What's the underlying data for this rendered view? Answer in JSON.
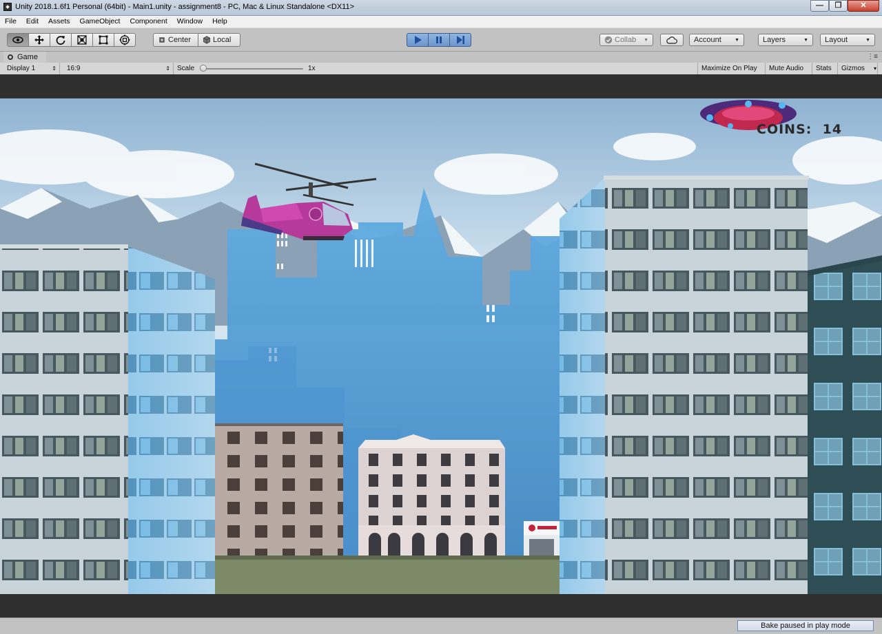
{
  "window": {
    "title": "Unity 2018.1.6f1 Personal (64bit) - Main1.unity - assignment8 - PC, Mac & Linux Standalone <DX11>",
    "minimize_glyph": "—",
    "restore_glyph": "❐",
    "close_glyph": "✕"
  },
  "menu": [
    "File",
    "Edit",
    "Assets",
    "GameObject",
    "Component",
    "Window",
    "Help"
  ],
  "toolbar": {
    "tools": [
      "view-icon",
      "move-icon",
      "rotate-icon",
      "scale-icon",
      "rect-icon",
      "transform-icon"
    ],
    "pivot_label": "Center",
    "space_label": "Local",
    "collab_label": "Collab",
    "account_label": "Account",
    "layers_label": "Layers",
    "layout_label": "Layout"
  },
  "game_tab": {
    "label": "Game"
  },
  "game_toolbar": {
    "display": "Display 1",
    "aspect": "16:9",
    "scale_label": "Scale",
    "scale_value": "1x",
    "maximize_on_play": "Maximize On Play",
    "mute_audio": "Mute Audio",
    "stats": "Stats",
    "gizmos": "Gizmos"
  },
  "hud": {
    "coins_label": "COINS:",
    "coins_value": "14"
  },
  "status": {
    "message": "Bake paused in play mode"
  },
  "colors": {
    "play_active": "#6d96cc",
    "sky_top": "#a6c4dc",
    "skyline_blue": "#4f9ad6",
    "ground": "#7d8a68"
  }
}
